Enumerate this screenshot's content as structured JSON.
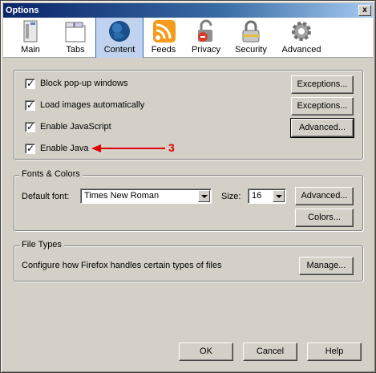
{
  "window": {
    "title": "Options",
    "close_label": "x"
  },
  "toolbar": {
    "tabs": [
      {
        "label": "Main",
        "icon": "main-icon"
      },
      {
        "label": "Tabs",
        "icon": "tabs-icon"
      },
      {
        "label": "Content",
        "icon": "globe-icon",
        "selected": true
      },
      {
        "label": "Feeds",
        "icon": "feed-icon"
      },
      {
        "label": "Privacy",
        "icon": "lock-icon"
      },
      {
        "label": "Security",
        "icon": "padlock-icon"
      },
      {
        "label": "Advanced",
        "icon": "gear-icon"
      }
    ]
  },
  "content": {
    "checks": [
      {
        "label": "Block pop-up windows",
        "checked": true,
        "button": "Exceptions..."
      },
      {
        "label": "Load images automatically",
        "checked": true,
        "button": "Exceptions..."
      },
      {
        "label": "Enable JavaScript",
        "checked": true,
        "button": "Advanced..."
      },
      {
        "label": "Enable Java",
        "checked": true
      }
    ],
    "annotation": {
      "number": "3",
      "color": "#e00000"
    }
  },
  "fonts": {
    "legend": "Fonts & Colors",
    "default_font_label": "Default font:",
    "default_font_value": "Times New Roman",
    "size_label": "Size:",
    "size_value": "16",
    "advanced_button": "Advanced...",
    "colors_button": "Colors..."
  },
  "filetypes": {
    "legend": "File Types",
    "description": "Configure how Firefox handles certain types of files",
    "manage_button": "Manage..."
  },
  "footer": {
    "ok": "OK",
    "cancel": "Cancel",
    "help": "Help"
  },
  "colors": {
    "titlebar": "#0a246a",
    "selected_tab": "#c1d2ee",
    "dialog_bg": "#d4d0c8"
  }
}
